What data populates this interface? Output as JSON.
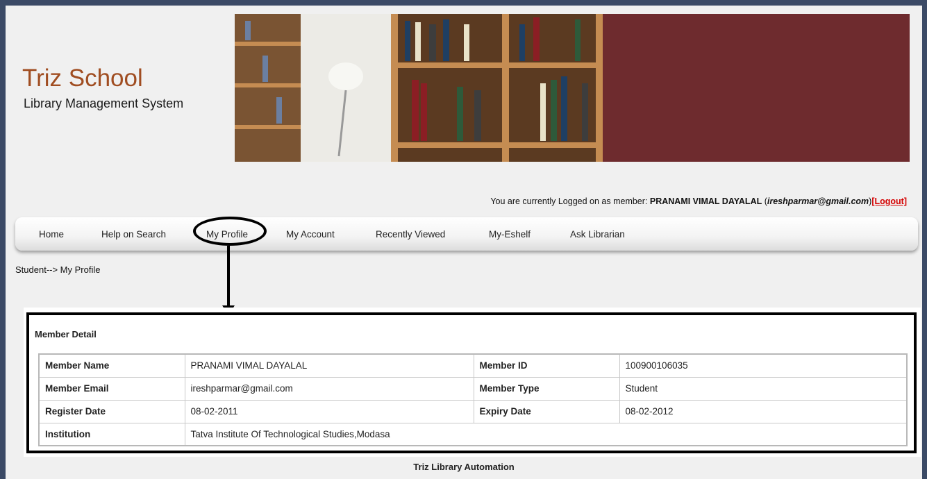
{
  "header": {
    "app_name": "Triz School",
    "app_subtitle": "Library Management System"
  },
  "login": {
    "prefix": "You are currently Logged on as member:",
    "member_name": "PRANAMI VIMAL DAYALAL",
    "email": "ireshparmar@gmail.com",
    "logout_label": "[Logout]"
  },
  "nav": {
    "items": [
      {
        "label": "Home"
      },
      {
        "label": "Help on Search"
      },
      {
        "label": "My Profile"
      },
      {
        "label": "My Account"
      },
      {
        "label": "Recently Viewed"
      },
      {
        "label": "My-Eshelf"
      },
      {
        "label": "Ask Librarian"
      }
    ]
  },
  "breadcrumb": "Student--> My Profile",
  "member_detail": {
    "title": "Member Detail",
    "rows": [
      {
        "l1": "Member Name",
        "v1": "PRANAMI VIMAL DAYALAL",
        "l2": "Member ID",
        "v2": "100900106035"
      },
      {
        "l1": "Member Email",
        "v1": "ireshparmar@gmail.com",
        "l2": "Member Type",
        "v2": "Student"
      },
      {
        "l1": "Register Date",
        "v1": "08-02-2011",
        "l2": "Expiry Date",
        "v2": "08-02-2012"
      },
      {
        "l1": "Institution",
        "v1": "Tatva Institute Of Technological Studies,Modasa",
        "l2": "",
        "v2": ""
      }
    ]
  },
  "footer": "Triz Library Automation",
  "colors": {
    "brand": "#a04d21",
    "banner_fill": "#6e2b2e",
    "logout": "#d40000",
    "frame": "#3b4a66"
  }
}
